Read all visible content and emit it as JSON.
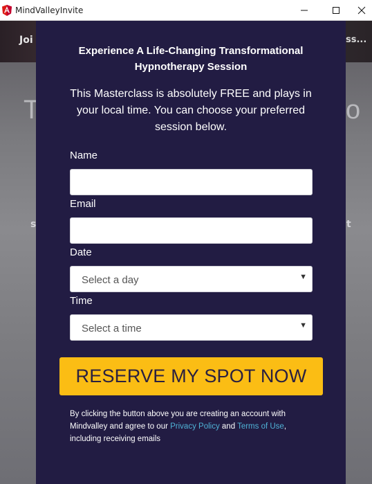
{
  "window": {
    "title": "MindValleyInvite"
  },
  "background": {
    "nav_text": "Joi",
    "nav_ellipsis": "ss...",
    "headline_left": "T",
    "headline_right": "o",
    "body_left": "s",
    "body_right": "t"
  },
  "modal": {
    "title_line1": "Experience A Life-Changing Transformational",
    "title_line2": "Hypnotherapy Session",
    "subtitle_line1": "This Masterclass is absolutely FREE and plays in",
    "subtitle_line2": "your local time. You can choose your preferred",
    "subtitle_line3": "session below.",
    "fields": {
      "name_label": "Name",
      "name_value": "",
      "email_label": "Email",
      "email_value": "",
      "date_label": "Date",
      "date_placeholder": "Select a day",
      "time_label": "Time",
      "time_placeholder": "Select a time"
    },
    "cta_label": "RESERVE MY SPOT NOW",
    "disclaimer": {
      "part1": "By clicking the button above you are creating an account with Mindvalley and agree to our ",
      "privacy_link": "Privacy Policy",
      "and": " and ",
      "terms_link": "Terms of Use",
      "part2": ", including receiving emails"
    }
  },
  "colors": {
    "modal_bg": "#221c43",
    "cta_bg": "#fbbd14",
    "link": "#4fb2d6"
  },
  "icons": [
    "angular-icon",
    "minimize-icon",
    "maximize-icon",
    "close-icon",
    "caret-down-icon"
  ]
}
